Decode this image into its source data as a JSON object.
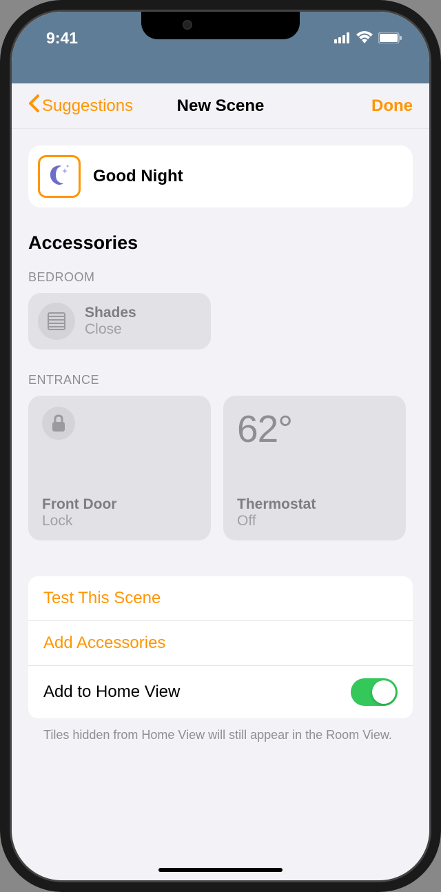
{
  "status": {
    "time": "9:41"
  },
  "nav": {
    "back_label": "Suggestions",
    "title": "New Scene",
    "done_label": "Done"
  },
  "scene": {
    "name": "Good Night"
  },
  "accessories": {
    "section_title": "Accessories",
    "rooms": [
      {
        "label": "BEDROOM",
        "tiles": [
          {
            "name": "Shades",
            "status": "Close",
            "icon": "shades-icon"
          }
        ]
      },
      {
        "label": "ENTRANCE",
        "tiles": [
          {
            "name": "Front Door",
            "status": "Lock",
            "icon": "lock-icon"
          },
          {
            "name": "Thermostat",
            "status": "Off",
            "value": "62°"
          }
        ]
      }
    ]
  },
  "actions": {
    "test_scene": "Test This Scene",
    "add_accessories": "Add Accessories",
    "add_home_view": "Add to Home View",
    "home_view_on": true
  },
  "footer": {
    "note": "Tiles hidden from Home View will still appear in the Room View."
  },
  "colors": {
    "accent": "#ff9500",
    "toggle_on": "#34c759",
    "status_bg": "#5f7d96"
  }
}
